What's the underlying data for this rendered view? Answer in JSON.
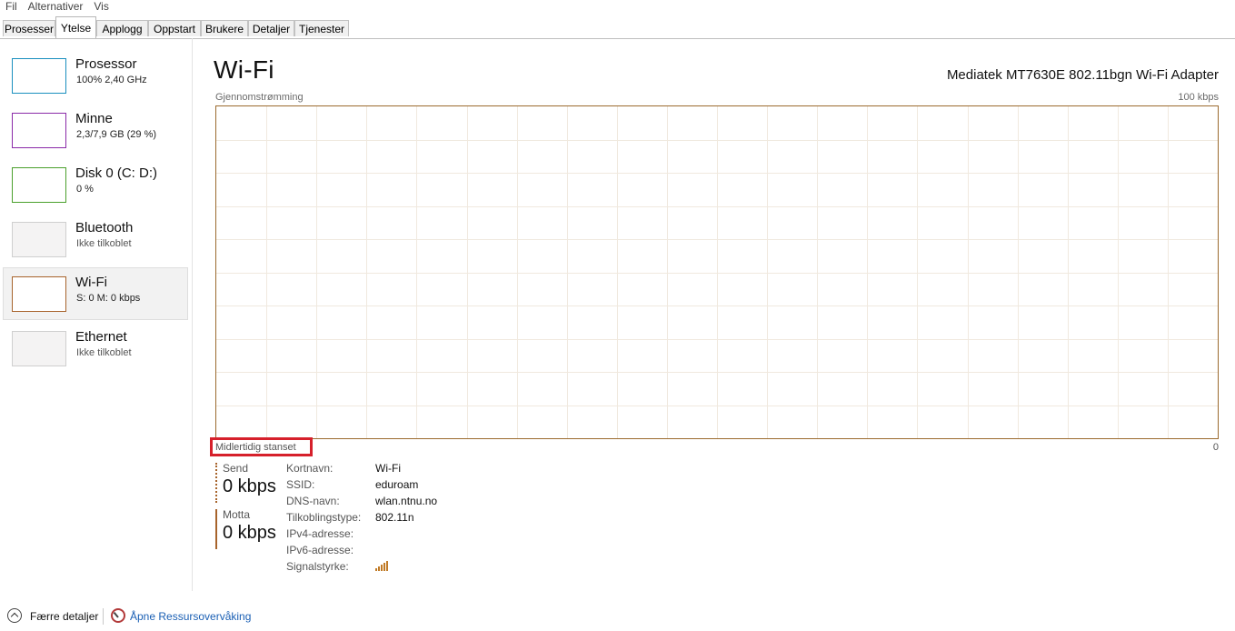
{
  "menu": [
    "Fil",
    "Alternativer",
    "Vis"
  ],
  "tabs": [
    {
      "label": "Prosesser",
      "active": false
    },
    {
      "label": "Ytelse",
      "active": true
    },
    {
      "label": "Applogg",
      "active": false
    },
    {
      "label": "Oppstart",
      "active": false
    },
    {
      "label": "Brukere",
      "active": false
    },
    {
      "label": "Detaljer",
      "active": false
    },
    {
      "label": "Tjenester",
      "active": false
    }
  ],
  "sidebar": {
    "items": [
      {
        "title": "Prosessor",
        "sub": "100%  2,40 GHz",
        "color": "#1a8fbf",
        "state": "active"
      },
      {
        "title": "Minne",
        "sub": "2,3/7,9 GB (29 %)",
        "color": "#8a2aa8",
        "state": "active"
      },
      {
        "title": "Disk 0 (C: D:)",
        "sub": "0 %",
        "color": "#4aa02c",
        "state": "active"
      },
      {
        "title": "Bluetooth",
        "sub": "Ikke tilkoblet",
        "color": "#cfcfcf",
        "state": "off"
      },
      {
        "title": "Wi-Fi",
        "sub": "S: 0  M: 0 kbps",
        "color": "#a7632b",
        "state": "selected"
      },
      {
        "title": "Ethernet",
        "sub": "Ikke tilkoblet",
        "color": "#cfcfcf",
        "state": "off"
      }
    ]
  },
  "main": {
    "title": "Wi-Fi",
    "adapter": "Mediatek MT7630E 802.11bgn Wi-Fi Adapter",
    "graph_label": "Gjennomstrømming",
    "graph_max": "100 kbps",
    "graph_min": "0",
    "paused": "Midlertidig stanset",
    "graph_color": "#9b6a2e",
    "grid_color": "#f0e9df"
  },
  "stats": {
    "send": {
      "label": "Send",
      "value": "0 kbps"
    },
    "receive": {
      "label": "Motta",
      "value": "0 kbps"
    }
  },
  "details": [
    {
      "key": "Kortnavn:",
      "value": "Wi-Fi"
    },
    {
      "key": "SSID:",
      "value": "eduroam"
    },
    {
      "key": "DNS-navn:",
      "value": "wlan.ntnu.no"
    },
    {
      "key": "Tilkoblingstype:",
      "value": "802.11n"
    },
    {
      "key": "IPv4-adresse:",
      "value": ""
    },
    {
      "key": "IPv6-adresse:",
      "value": ""
    },
    {
      "key": "Signalstyrke:",
      "value": "",
      "icon": "signal-strength-icon"
    }
  ],
  "footer": {
    "fewer": "Færre detaljer",
    "fewer_icon": "chevron-up-circle-icon",
    "resource_monitor": "Åpne Ressursovervåking",
    "resource_icon": "resource-monitor-icon"
  }
}
